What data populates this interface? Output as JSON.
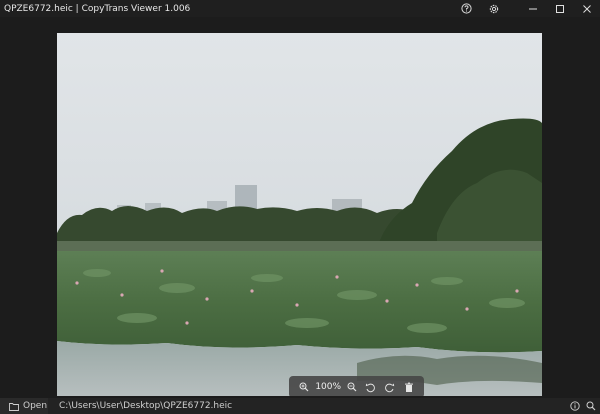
{
  "window": {
    "title": "QPZE6772.heic | CopyTrans Viewer 1.006"
  },
  "titlebar": {
    "icons": [
      "help-icon",
      "settings-icon",
      "minimize-icon",
      "maximize-icon",
      "close-icon"
    ]
  },
  "image": {
    "description_icon": "photo-lake-lotus"
  },
  "zoombar": {
    "zoom_level": "100%",
    "icons": [
      "zoom-in-icon",
      "zoom-out-icon",
      "rotate-left-icon",
      "rotate-right-icon",
      "delete-icon"
    ]
  },
  "statusbar": {
    "open_label": "Open",
    "file_path": "C:\\Users\\User\\Desktop\\QPZE6772.heic",
    "icons": [
      "info-icon",
      "search-icon"
    ]
  },
  "colors": {
    "titlebar_bg": "#1f1f1f",
    "viewer_bg": "#1c1c1c",
    "statusbar_bg": "#232323",
    "zoombar_bg": "#464646"
  }
}
